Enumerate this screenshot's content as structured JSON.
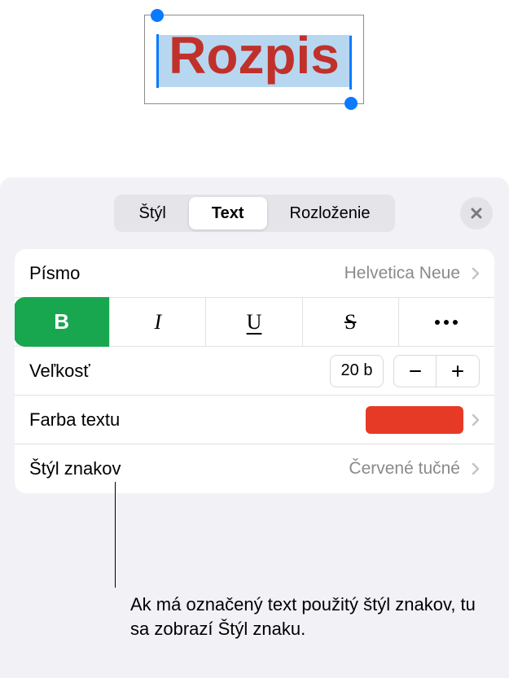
{
  "canvas": {
    "textbox_content": "Rozpis"
  },
  "inspector": {
    "tabs": {
      "style": "Štýl",
      "text": "Text",
      "layout": "Rozloženie"
    },
    "font": {
      "label": "Písmo",
      "value": "Helvetica Neue"
    },
    "styleButtons": {
      "bold": "B",
      "italic": "I",
      "underline": "U",
      "strike": "S"
    },
    "size": {
      "label": "Veľkosť",
      "value": "20 b"
    },
    "textColor": {
      "label": "Farba textu",
      "swatch": "#e63a27"
    },
    "charStyle": {
      "label": "Štýl znakov",
      "value": "Červené tučné"
    }
  },
  "callout": "Ak má označený text použitý štýl znakov, tu sa zobrazí Štýl znaku."
}
